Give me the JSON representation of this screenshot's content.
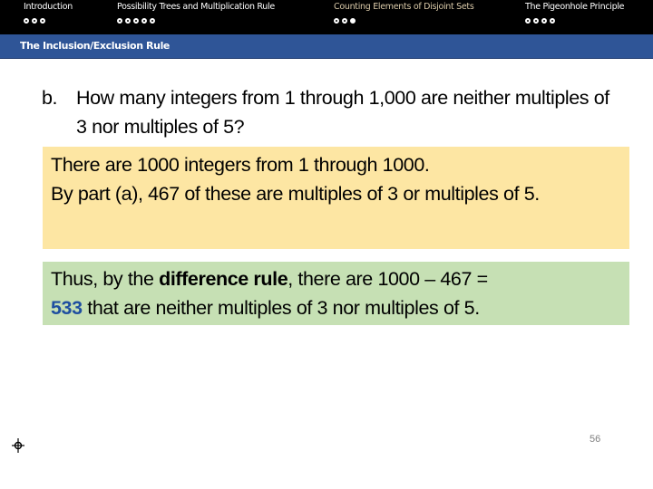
{
  "navbar": {
    "sections": [
      {
        "title": "Introduction",
        "dots": 3,
        "filled_index": -1,
        "active": false
      },
      {
        "title": "Possibility Trees and Multiplication Rule",
        "dots": 5,
        "filled_index": -1,
        "active": false
      },
      {
        "title": "Counting Elements of Disjoint Sets",
        "dots": 3,
        "filled_index": 2,
        "active": true
      },
      {
        "title": "The Pigeonhole Principle",
        "dots": 4,
        "filled_index": -1,
        "active": false
      }
    ]
  },
  "subsection": {
    "title": "The Inclusion/Exclusion Rule"
  },
  "question": {
    "label": "b.",
    "text": "How many integers from 1 through 1,000 are neither multiples of 3 nor multiples of 5?"
  },
  "answer_box_1": {
    "line1": "There are 1000 integers from 1 through 1000.",
    "line2": "By part (a), 467 of these are multiples of 3 or multiples of 5."
  },
  "answer_box_2": {
    "prefix": "Thus, by the ",
    "bold_term": "difference rule",
    "middle": ", there are 1000 – 467 = ",
    "result": "533",
    "suffix": " that are neither multiples of 3 nor multiples of 5."
  },
  "footer": {
    "page_number": "56",
    "crosshair_icon": "crosshair-icon"
  },
  "colors": {
    "navbar_bg": "#000000",
    "subbar_bg": "#2f5597",
    "yellow_box": "#fde6a3",
    "green_box": "#c6e0b4",
    "result_color": "#1f4fa0"
  }
}
